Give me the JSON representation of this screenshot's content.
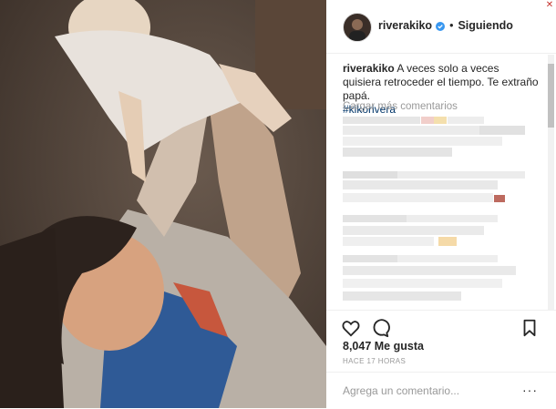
{
  "post": {
    "username": "riverakiko",
    "follow_status": "Siguiendo",
    "caption_user": "riverakiko",
    "caption_text": "A veces solo a veces quisiera retroceder el tiempo. Te extraño papá.",
    "hashtag": "#kikorivera",
    "load_more": "Cargar más comentarios",
    "likes": "8,047 Me gusta",
    "timestamp": "HACE 17 HORAS",
    "comment_placeholder": "Agrega un comentario...",
    "more_options": "···"
  },
  "icons": [
    "verified-badge-icon",
    "heart-icon",
    "comment-icon",
    "bookmark-icon",
    "close-icon"
  ],
  "colors": {
    "verified": "#3897f0",
    "hashtag": "#003569",
    "muted": "#999999"
  }
}
